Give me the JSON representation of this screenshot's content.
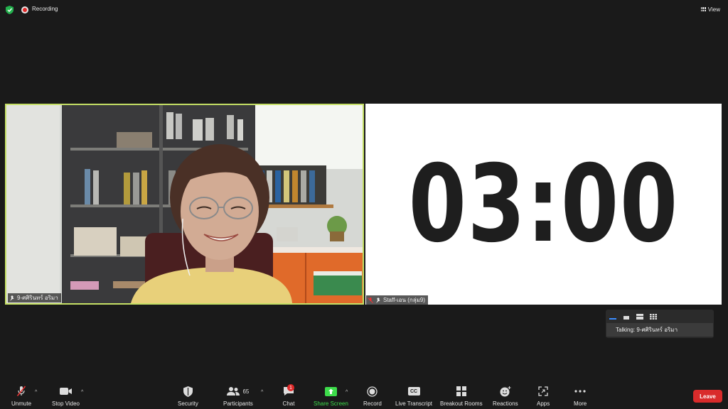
{
  "topbar": {
    "recording_label": "Recording",
    "view_label": "View"
  },
  "tiles": {
    "left_name": "9-ศศิรินทร์ อริมา",
    "right_name": "Staff-เอน (กลุ่ม9)",
    "timer_text": "03:00"
  },
  "talking": {
    "label": "Talking:",
    "name": "9-ศศิรินทร์ อริมา"
  },
  "toolbar": {
    "unmute": "Unmute",
    "stop_video": "Stop Video",
    "security": "Security",
    "participants": "Participants",
    "participants_count": "65",
    "chat": "Chat",
    "chat_badge": "1",
    "share_screen": "Share Screen",
    "record": "Record",
    "live_transcript": "Live Transcript",
    "cc": "CC",
    "breakout_rooms": "Breakout Rooms",
    "reactions": "Reactions",
    "apps": "Apps",
    "more": "More",
    "leave": "Leave"
  },
  "colors": {
    "background": "#1a1a1a",
    "active_speaker_border": "#c5e065",
    "leave": "#d92b2b",
    "share": "#3ddc4b",
    "recording": "#e02828"
  }
}
